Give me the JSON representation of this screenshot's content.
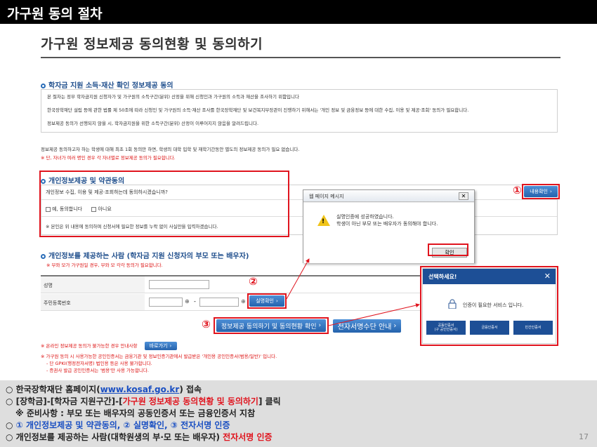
{
  "header": {
    "title": "가구원 동의 절차"
  },
  "page": {
    "title": "가구원 정보제공 동의현황 및 동의하기"
  },
  "section1": {
    "title": "학자금 지원 소득·재산 확인 정보제공 동의",
    "lines": [
      "본 절차는 정부 학자금지원 신청자가 및 가구원의 소득구간(분위) 산정을 위해 신청인과 가구원의 소득과 재산을 조사하기 위함입니다",
      "한국장학재단 설립 등에 관한 법률 제 50조에 따라 신청인 및 가구원의 소득·재산 조사를 한국장학재단 및 보건복지부장관이 진행하기 위해서는 '개인 정보 및 금융정보 등에 대한 수집, 이용 및 제공·조회' 동의가 필요합니다.",
      "정보제공 동의가 선행되지 않을 시, 학자금지원을 위한 소득구간(분위) 산정이 이루어지지 않음을 알려드립니다."
    ]
  },
  "notice": {
    "line1": "정보제공 동의하고자 하는 학생에 대해 최초 1회 동의만 하면, 학생의 대학 입학 및 재학기간동안 별도의 정보제공 동의가 필요 없습니다.",
    "line2": "※ 단, 자녀가 여러 명인 경우 각 자녀별로 정보제공 동의가 필요합니다."
  },
  "section2": {
    "title": "개인정보제공 및 약관동의",
    "question": "개인정보 수집, 이용 및 제공·조회하는데 동의하시겠습니까?",
    "yes": "예, 동의합니다",
    "no": "아니요",
    "note": "※ 본인은 위 내용에 동의하며 신청서에 필요한 정보를 누락 없이 사실만을 입력하겠습니다.",
    "detail_button": "내용확인"
  },
  "dialog": {
    "title": "웹 페이지 메시지",
    "close": "✕",
    "message1": "실명인증에 성공하였습니다.",
    "message2": "학생이 아닌 부모 또는 배우자가 동의해야 합니다.",
    "ok": "확인"
  },
  "section3": {
    "title": "개인정보를 제공하는 사람 (학자금 지원 신청자의 부모 또는 배우자)",
    "sub": "※ 부와 모가 가구원일 경우, 부와 모 각각 동의가 필요합니다.",
    "name_label": "성명",
    "rrn_label": "주민등록번호",
    "dash": "-",
    "verify_button": "실명확인"
  },
  "actions": {
    "consent_button": "정보제공 동의하기 및 동의현황 확인",
    "esign_button": "전자서명수단 안내"
  },
  "select": {
    "title": "선택하세요!",
    "close": "✕",
    "message": "인증이 필요한 서비스 입니다.",
    "options": [
      "공동인증서\n(구 공인인증서)",
      "금융인증서",
      "민간인증서"
    ]
  },
  "notes": {
    "line1": "※ 온라인 정보제공 동의가 불가능한 경우 안내사항",
    "line1_button": "바로가기",
    "line2": "※ 가구원 동의 시 사용가능한 공인인증서는 금융기관 및 정보인증기관에서 발급받은 '개인용 공인인증서(범용/일반)' 입니다.",
    "line3": "- 단 GPKI(행정전자서명) 법인용 등은 사용 불가합니다.",
    "line4": "- 증권사 발급 공인인증서는 '범용'만 사용 가능합니다."
  },
  "markers": {
    "one": "①",
    "two": "②",
    "three": "③"
  },
  "bottom": {
    "line1_pre": "○ 한국장학재단 홈페이지(",
    "line1_link": "www.kosaf.go.kr",
    "line1_post": ") 접속",
    "line2_pre": "○ [장학금]-[학자금 지원구간]-[",
    "line2_red": "가구원 정보제공 동의현황 및 동의하기",
    "line2_post": "] 클릭",
    "line3": "※ 준비사항 : 부모 또는 배우자의 공동인증서 또는 금융인증서 지참",
    "line4_pre": "○ ",
    "line4_blue": "① 개인정보제공 및 약관동의, ② 실명확인, ③ 전자서명 인증",
    "line5_pre": "○ 개인정보를 제공하는 사람(대학원생의 부·모 또는 배우자) ",
    "line5_red": "전자서명 인증",
    "page_number": "17"
  },
  "colors": {
    "accent_red": "#e0141e",
    "brand_blue": "#1d4f96",
    "header_bg": "#000000"
  }
}
